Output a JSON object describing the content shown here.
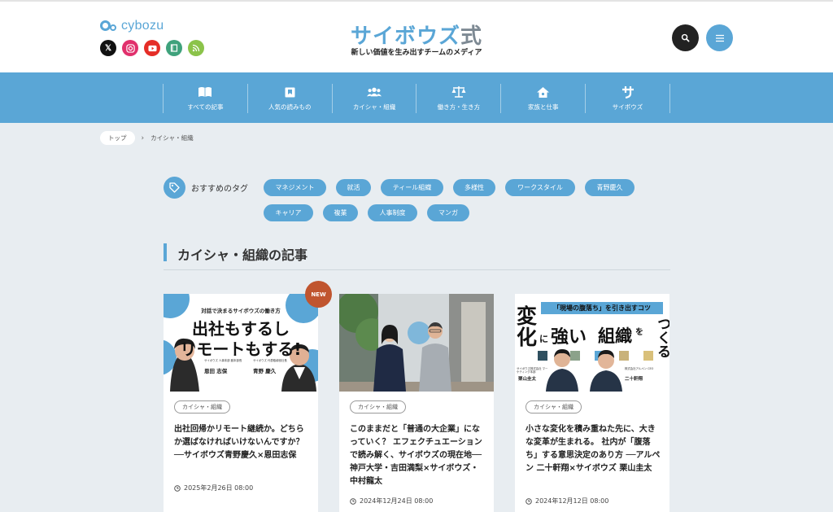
{
  "header": {
    "brand": "cybozu",
    "site_title_main": "サイボウズ",
    "site_title_suffix": "式",
    "tagline": "新しい価値を生み出すチームのメディア",
    "socials": [
      "x-icon",
      "instagram-icon",
      "youtube-icon",
      "note-icon",
      "rss-icon"
    ]
  },
  "nav": {
    "items": [
      {
        "label": "すべての記事",
        "icon": "book-icon"
      },
      {
        "label": "人気の読みもの",
        "icon": "bookmark-icon"
      },
      {
        "label": "カイシャ・組織",
        "icon": "people-icon"
      },
      {
        "label": "働き方・生き方",
        "icon": "scale-icon"
      },
      {
        "label": "家族と仕事",
        "icon": "home-icon"
      },
      {
        "label": "サイボウズ",
        "icon": "sa-icon"
      }
    ]
  },
  "breadcrumb": {
    "top": "トップ",
    "current": "カイシャ・組織"
  },
  "tags": {
    "title": "おすすめのタグ",
    "row1": [
      "マネジメント",
      "就活",
      "ティール組織",
      "多様性",
      "ワークスタイル",
      "青野慶久"
    ],
    "row2": [
      "キャリア",
      "複業",
      "人事制度",
      "マンガ"
    ]
  },
  "section": {
    "title": "カイシャ・組織の記事"
  },
  "articles": [
    {
      "category": "カイシャ・組織",
      "title": "出社回帰かリモート継続か。どちらか選ばなければいけないんですか？──サイボウズ青野慶久×恩田志保",
      "date": "2025年2月26日 08:00",
      "badge": "NEW",
      "thumb": {
        "sub": "対話で決まるサイボウズの働き方",
        "line1": "出社もするし",
        "line2": "リモートもする!",
        "person1_role": "サイボウズ 人事本部 副本部長",
        "person1_name": "恩田 志保",
        "person2_role": "サイボウズ 代表取締役社長",
        "person2_name": "青野 慶久"
      }
    },
    {
      "category": "カイシャ・組織",
      "title": "このままだと「普通の大企業」になっていく？ エフェクチュエーションで読み解く、サイボウズの現在地──神戸大学・吉田満梨×サイボウズ・中村龍太",
      "date": "2024年12月24日 08:00"
    },
    {
      "category": "カイシャ・組織",
      "title": "小さな変化を積み重ねた先に、大きな変革が生まれる。 社内が「腹落ち」する意思決定のあり方 ──アルペン 二十軒翔×サイボウズ 栗山圭太",
      "date": "2024年12月12日 08:00",
      "thumb": {
        "banner": "「現場の腹落ち」を引き出すコツ",
        "big1": "変",
        "big2": "化",
        "small1": "に",
        "big3": "強い",
        "big4": "組織",
        "small2": "を",
        "big5": "つくる",
        "person1_role": "サイボウズ株式会社 マーケティング本部",
        "person1_name": "栗山圭太",
        "person2_role": "株式会社アルペン CEO",
        "person2_name": "二十軒翔"
      }
    }
  ],
  "colors": {
    "accent": "#5aa6d6",
    "badge": "#c0552f",
    "background": "#e8edf1"
  }
}
